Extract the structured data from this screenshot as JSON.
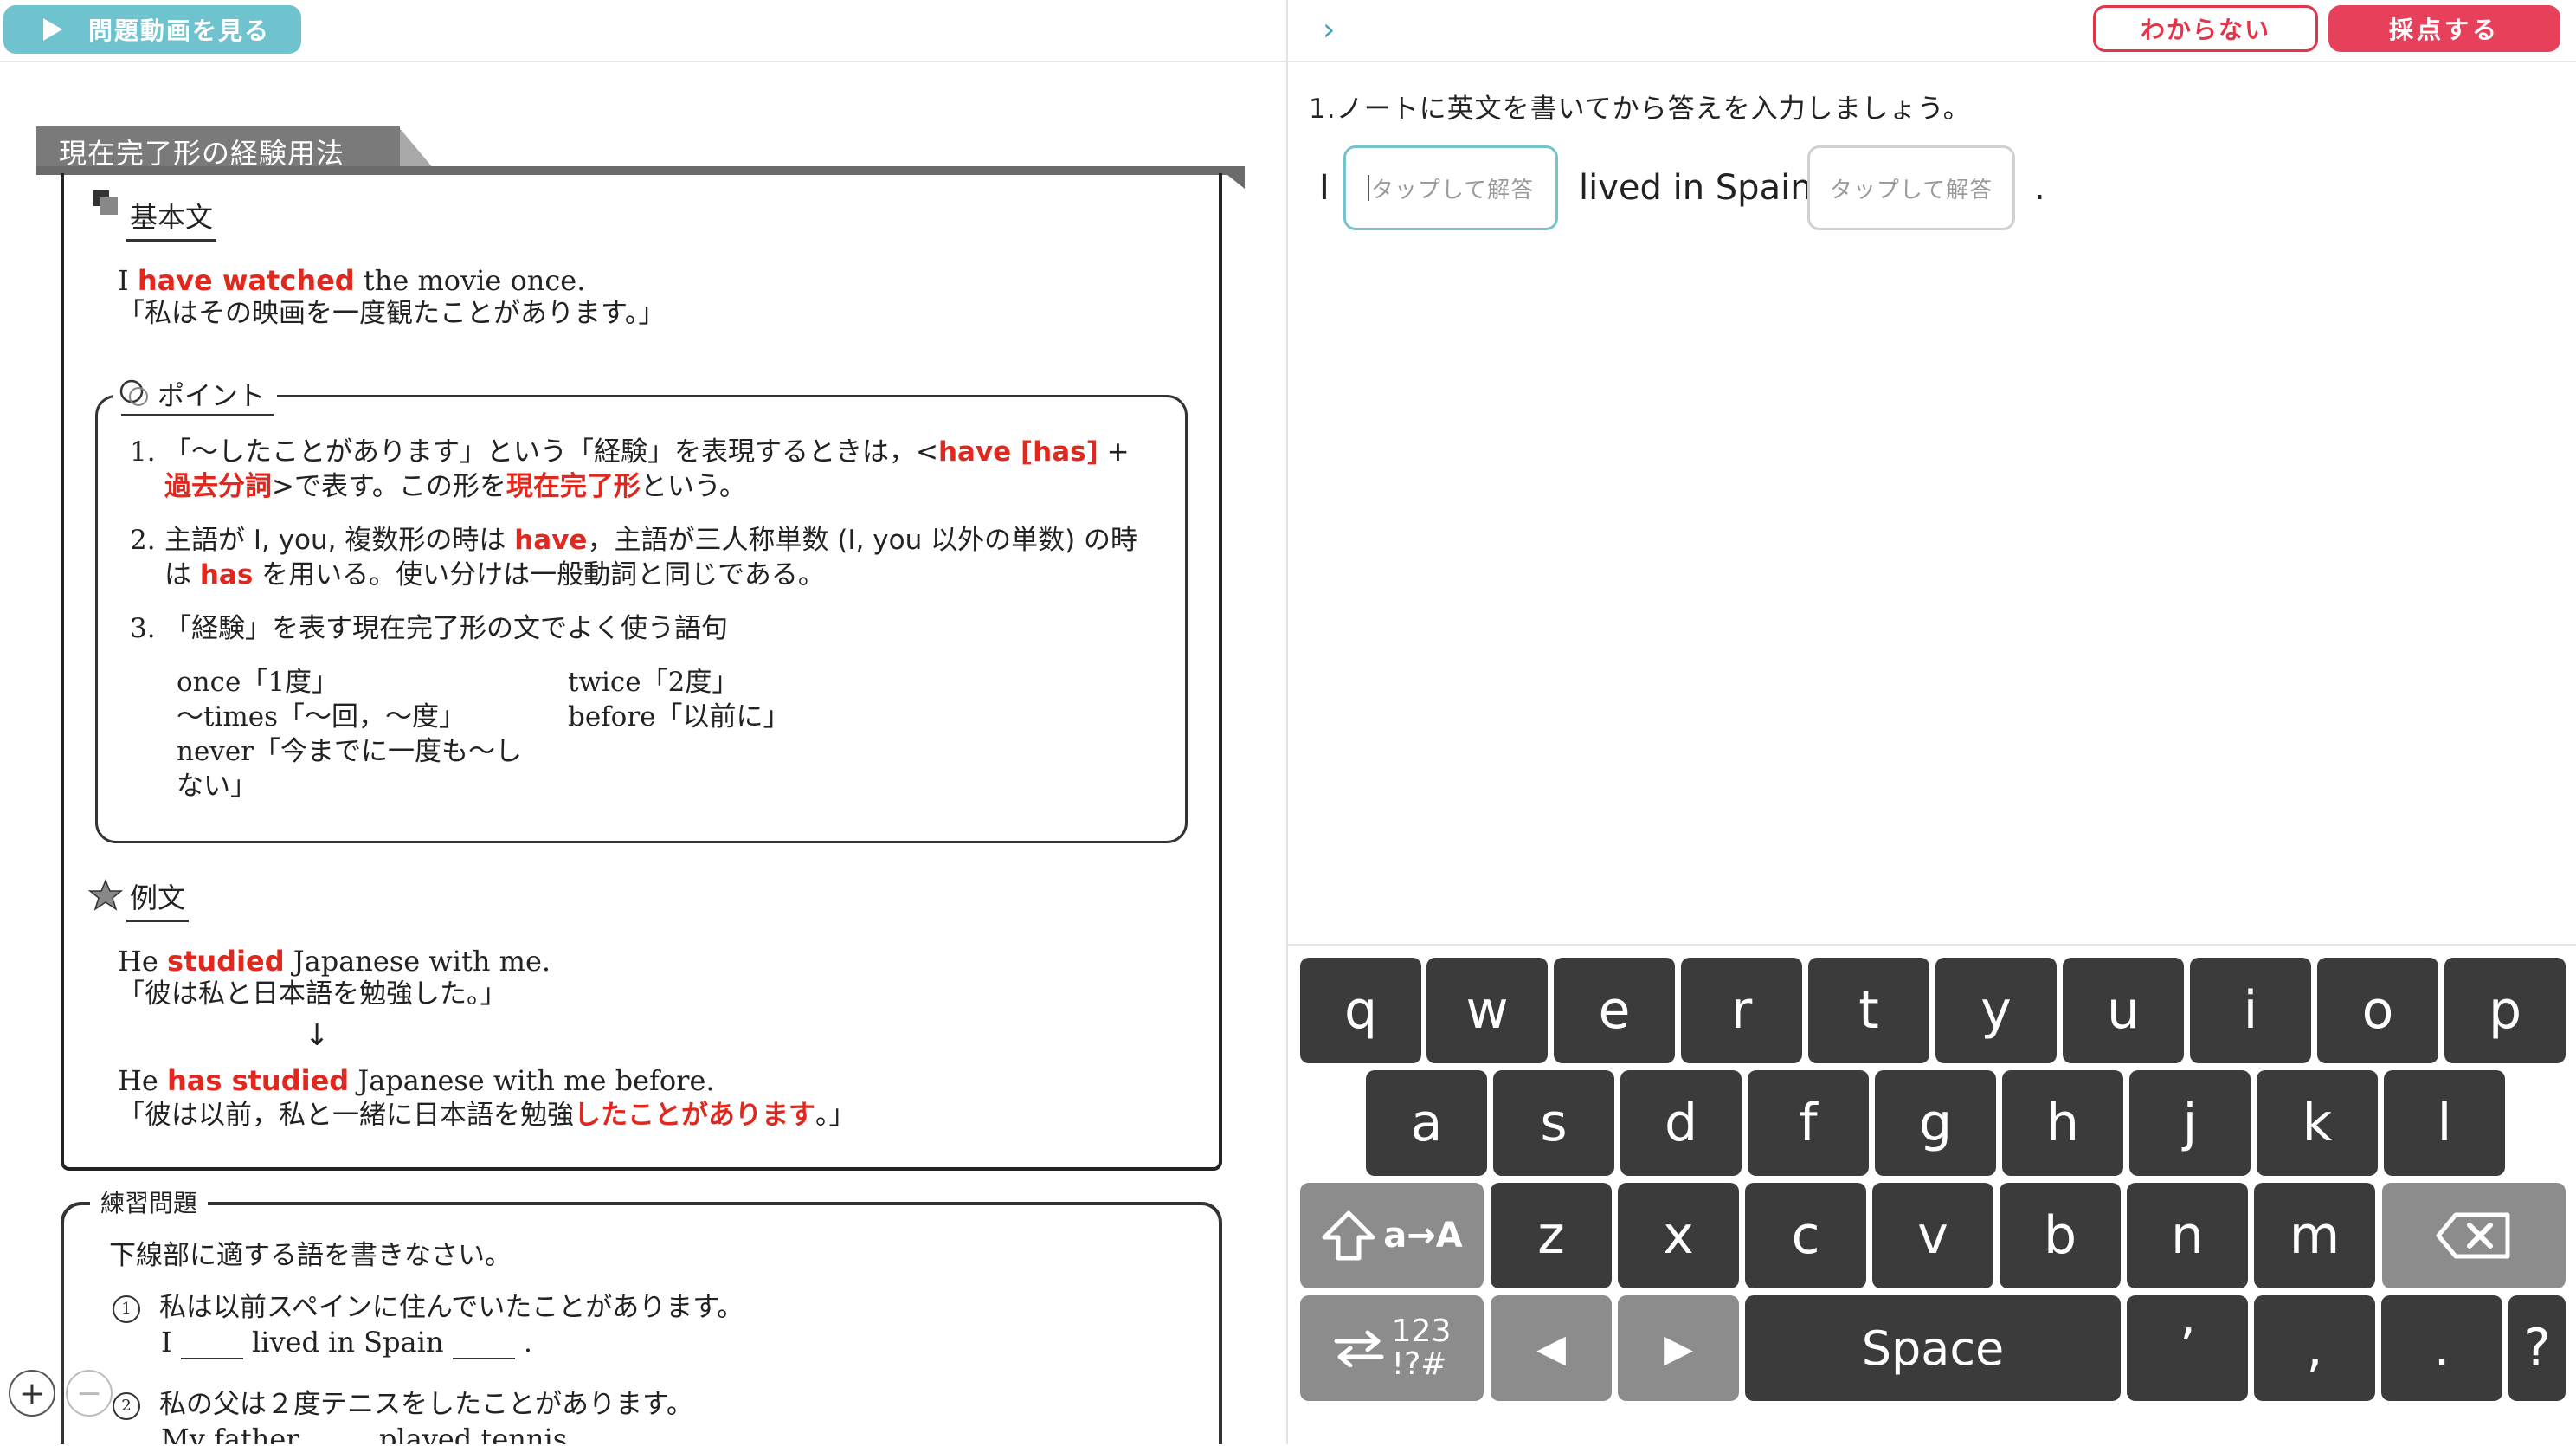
{
  "left": {
    "video_button": "問題動画を見る",
    "section_title": "現在完了形の経験用法",
    "basic": {
      "heading": "基本文",
      "en_pre": "I ",
      "en_red": "have watched",
      "en_post": " the movie once.",
      "jp": "「私はその映画を一度観たことがあります。」"
    },
    "point": {
      "heading": "ポイント",
      "items": [
        {
          "num": "1.",
          "l1_a": "「〜したことがあります」という「経験」を表現するときは，<",
          "l1_red": "have [has]",
          "l1_b": " +",
          "l2_red": "過去分詞",
          "l2_a": ">で表す。この形を",
          "l2_red2": "現在完了形",
          "l2_b": "という。"
        },
        {
          "num": "2.",
          "l1_a": "主語が I, you, 複数形の時は ",
          "l1_red": "have",
          "l1_b": "，主語が三人称単数 (I, you 以外の単数) の時",
          "l2_a": "は ",
          "l2_red": "has",
          "l2_b": " を用いる。使い分けは一般動詞と同じである。"
        },
        {
          "num": "3.",
          "l1_a": "「経験」を表す現在完了形の文でよく使う語句"
        }
      ],
      "words": {
        "w1": "once「1度」",
        "w2": "twice「2度」",
        "w3": "〜times「〜回，〜度」",
        "w4": "before「以前に」",
        "w5a": "never「今までに一度も〜し",
        "w5b": "ない」"
      }
    },
    "example": {
      "heading": "例文",
      "l1_pre": "He ",
      "l1_red": "studied",
      "l1_post": " Japanese with me.",
      "l1_jp": "「彼は私と日本語を勉強した。」",
      "arrow": "↓",
      "l2_pre": "He ",
      "l2_red": "has studied",
      "l2_post": " Japanese with me before.",
      "l2_jp_a": "「彼は以前，私と一緒に日本語を勉強",
      "l2_jp_red": "したことがあります",
      "l2_jp_b": "。」"
    },
    "practice": {
      "label": "練習問題",
      "instruction": "下線部に適する語を書きなさい。",
      "q1_num": "1",
      "q1_jp": "私は以前スペインに住んでいたことがあります。",
      "q1_en_a": "I",
      "q1_en_b": "lived in Spain",
      "q1_en_c": ".",
      "q2_num": "2",
      "q2_jp": "私の父は２度テニスをしたことがあります。",
      "q2_en_a": "My father",
      "q2_en_b": "played tennis"
    },
    "zoom_in": "+",
    "zoom_out": "−"
  },
  "right": {
    "chevron": "›",
    "dont_know": "わからない",
    "grade": "採点する",
    "instruction": "1.ノートに英文を書いてから答えを入力しましょう。",
    "answer": {
      "word1": "I",
      "input1_placeholder": "タップして解答",
      "word2": "lived in Spain",
      "input2_placeholder": "タップして解答",
      "period": "."
    }
  },
  "keyboard": {
    "row1": [
      "q",
      "w",
      "e",
      "r",
      "t",
      "y",
      "u",
      "i",
      "o",
      "p"
    ],
    "row2": [
      "a",
      "s",
      "d",
      "f",
      "g",
      "h",
      "j",
      "k",
      "l"
    ],
    "row3": [
      "z",
      "x",
      "c",
      "v",
      "b",
      "n",
      "m"
    ],
    "shift": "a→A",
    "num_top": "123",
    "num_bottom": "!?#",
    "left_arrow": "◀",
    "right_arrow": "▶",
    "space": "Space",
    "apostrophe": "’",
    "comma": ",",
    "period": ".",
    "question": "?"
  }
}
